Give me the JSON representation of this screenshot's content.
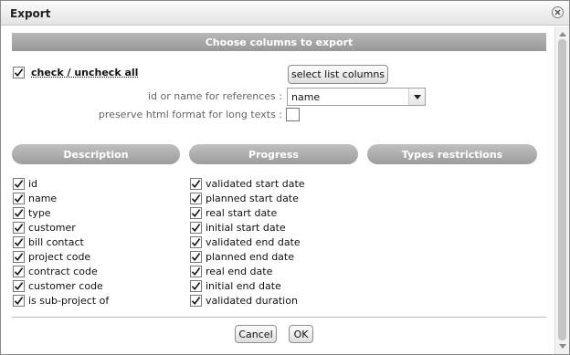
{
  "dialog": {
    "title": "Export",
    "close_icon": "close-icon"
  },
  "section": {
    "title": "Choose columns to export"
  },
  "check_all": {
    "label": "check / uncheck all",
    "checked": true
  },
  "select_list_columns_label": "select list columns",
  "references": {
    "label": "id or name for references :",
    "value": "name"
  },
  "preserve_html": {
    "label": "preserve html format for long texts :",
    "checked": false
  },
  "columns": {
    "description": {
      "title": "Description",
      "items": [
        {
          "label": "id",
          "checked": true
        },
        {
          "label": "name",
          "checked": true
        },
        {
          "label": "type",
          "checked": true
        },
        {
          "label": "customer",
          "checked": true
        },
        {
          "label": "bill contact",
          "checked": true
        },
        {
          "label": "project code",
          "checked": true
        },
        {
          "label": "contract code",
          "checked": true
        },
        {
          "label": "customer code",
          "checked": true
        },
        {
          "label": "is sub-project of",
          "checked": true
        }
      ]
    },
    "progress": {
      "title": "Progress",
      "items": [
        {
          "label": "validated start date",
          "checked": true
        },
        {
          "label": "planned start date",
          "checked": true
        },
        {
          "label": "real start date",
          "checked": true
        },
        {
          "label": "initial start date",
          "checked": true
        },
        {
          "label": "validated end date",
          "checked": true
        },
        {
          "label": "planned end date",
          "checked": true
        },
        {
          "label": "real end date",
          "checked": true
        },
        {
          "label": "initial end date",
          "checked": true
        },
        {
          "label": "validated duration",
          "checked": true
        }
      ]
    },
    "types_restrictions": {
      "title": "Types restrictions",
      "items": []
    }
  },
  "buttons": {
    "cancel": "Cancel",
    "ok": "OK"
  }
}
